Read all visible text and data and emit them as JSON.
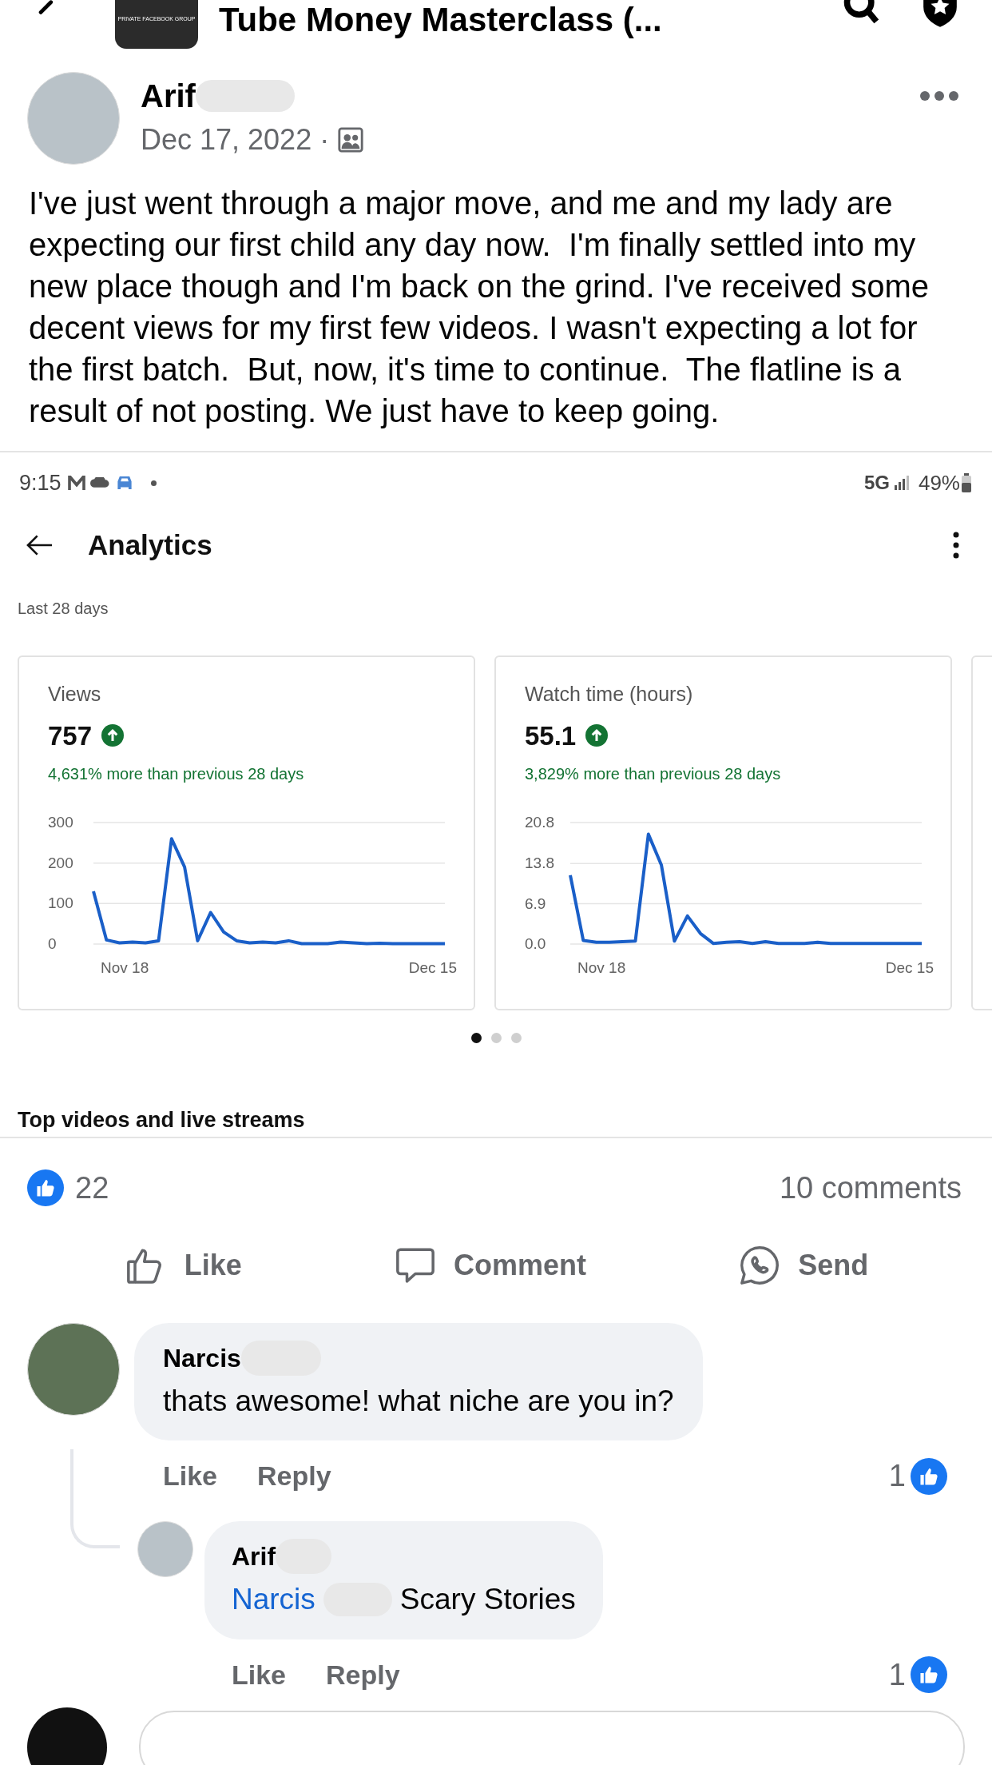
{
  "header": {
    "title": "Tube Money Masterclass (...",
    "group_badge": "PRIVATE FACEBOOK GROUP"
  },
  "post": {
    "author": "Arif",
    "date": "Dec 17, 2022",
    "separator": "·",
    "text": "I've just went through a major move, and me and my lady are expecting our first child any day now.  I'm finally settled into my new place though and I'm back on the grind. I've received some decent views for my first few videos. I wasn't expecting a lot for the first batch.  But, now, it's time to continue.  The flatline is a result of not posting. We just have to keep going."
  },
  "screenshot": {
    "status_bar": {
      "time": "9:15",
      "network": "5G",
      "battery": "49%"
    },
    "title": "Analytics",
    "period": "Last 28 days",
    "cards": [
      {
        "label": "Views",
        "value": "757",
        "change": "4,631% more than previous 28 days",
        "x_start": "Nov 18",
        "x_end": "Dec 15",
        "chart_data": {
          "type": "line",
          "yticks": [
            0,
            100,
            200,
            300
          ],
          "ylim": [
            0,
            300
          ],
          "series": [
            {
              "color": "#1a5fc8",
              "values": [
                130,
                10,
                3,
                5,
                3,
                8,
                260,
                190,
                8,
                78,
                30,
                8,
                3,
                5,
                3,
                8,
                1,
                1,
                1,
                5,
                3,
                1,
                2,
                1,
                1,
                1,
                1,
                1
              ]
            }
          ]
        }
      },
      {
        "label": "Watch time (hours)",
        "value": "55.1",
        "change": "3,829% more than previous 28 days",
        "x_start": "Nov 18",
        "x_end": "Dec 15",
        "chart_data": {
          "type": "line",
          "yticks": [
            {
              "value": 0,
              "label": "0.0"
            },
            6.9,
            13.8,
            20.8
          ],
          "ylim": [
            0,
            20.8
          ],
          "series": [
            {
              "color": "#1a5fc8",
              "values": [
                11.8,
                0.6,
                0.3,
                0.3,
                0.4,
                0.5,
                18.8,
                13.5,
                0.5,
                4.8,
                1.8,
                0.1,
                0.3,
                0.4,
                0.1,
                0.4,
                0.1,
                0.1,
                0.1,
                0.3,
                0.1,
                0.1,
                0.1,
                0.1,
                0.1,
                0.1,
                0.1,
                0.1
              ]
            }
          ]
        }
      }
    ],
    "pager": [
      {
        "selected": true
      },
      {
        "selected": false
      },
      {
        "selected": false
      }
    ],
    "section_title": "Top videos and live streams"
  },
  "reactions": {
    "likes": "22",
    "comments": "10 comments"
  },
  "actions": [
    {
      "kind": "like",
      "label": "Like"
    },
    {
      "kind": "comment",
      "label": "Comment"
    },
    {
      "kind": "send",
      "label": "Send"
    }
  ],
  "comments": [
    {
      "author": "Narcis",
      "text": "thats awesome! what niche are you in?",
      "like": "Like",
      "reply": "Reply",
      "likes": "1",
      "children": [
        {
          "author": "Arif",
          "mention": "Narcis",
          "text": "Scary Stories",
          "like": "Like",
          "reply": "Reply",
          "likes": "1"
        }
      ]
    }
  ]
}
